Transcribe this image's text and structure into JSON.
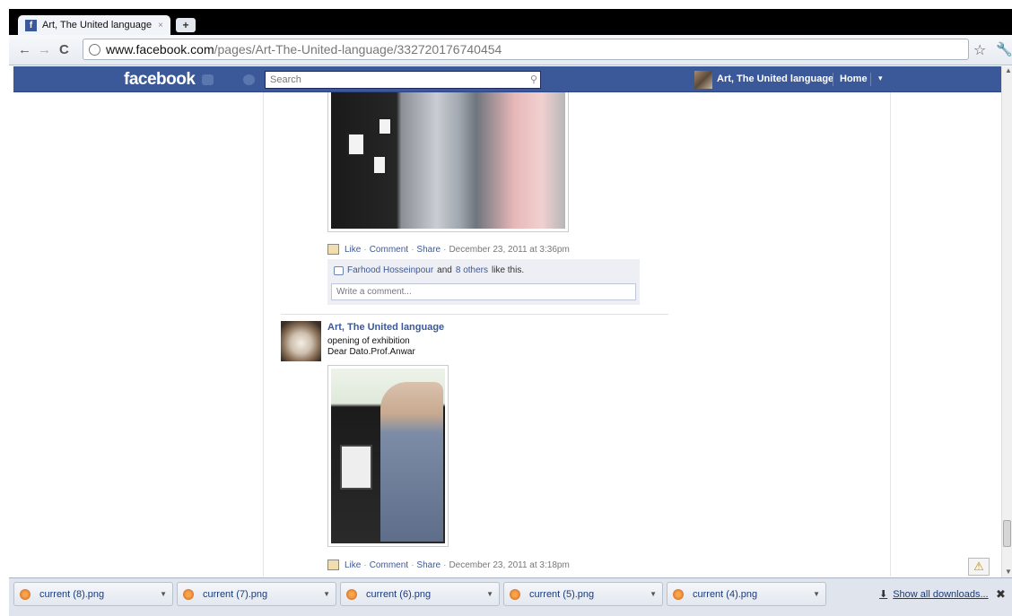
{
  "browser": {
    "tab_title": "Art, The United language",
    "tab_close": "×",
    "new_tab": "+",
    "url_host": "www.facebook.com",
    "url_path": "/pages/Art-The-United-language/332720176740454",
    "back_icon": "←",
    "forward_icon": "→",
    "reload_icon": "C",
    "star_icon": "☆",
    "wrench_icon": "🔧"
  },
  "fb_header": {
    "logo": "facebook",
    "search_placeholder": "Search",
    "page_name": "Art, The United language",
    "home": "Home",
    "caret": "▾",
    "brand_color": "#3b5998"
  },
  "posts": [
    {
      "actions": {
        "like": "Like",
        "comment": "Comment",
        "share": "Share",
        "timestamp": "December 23, 2011 at 3:36pm"
      },
      "likes": {
        "liker": "Farhood Hosseinpour",
        "and": "and",
        "others": "8 others",
        "suffix": "like this."
      },
      "comment_placeholder": "Write a comment..."
    },
    {
      "author": "Art, The United language",
      "text_line1": "opening of exhibition",
      "text_line2": "Dear Dato.Prof.Anwar",
      "actions": {
        "like": "Like",
        "comment": "Comment",
        "share": "Share",
        "timestamp": "December 23, 2011 at 3:18pm"
      }
    }
  ],
  "separator_dot": "·",
  "downloads": {
    "items": [
      {
        "name": "current (8).png"
      },
      {
        "name": "current (7).png"
      },
      {
        "name": "current (6).png"
      },
      {
        "name": "current (5).png"
      },
      {
        "name": "current (4).png"
      }
    ],
    "show_all": "Show all downloads...",
    "close": "✖"
  },
  "warning_icon": "⚠"
}
